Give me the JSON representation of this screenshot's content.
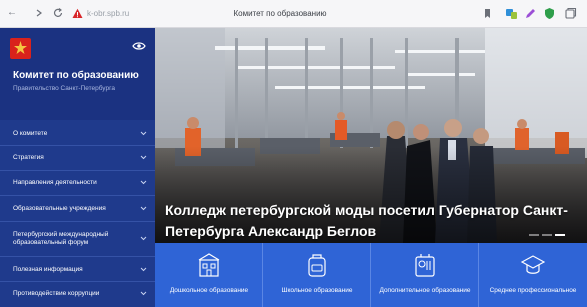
{
  "browser": {
    "url": "k-obr.spb.ru",
    "tab_title": "Комитет по образованию",
    "icons": [
      "back-icon",
      "forward-icon",
      "reload-icon",
      "warning-icon",
      "bookmark-icon",
      "extensions-icon",
      "pen-icon",
      "shield-icon",
      "tabs-icon"
    ]
  },
  "sidebar": {
    "title": "Комитет по образованию",
    "subtitle": "Правительство Санкт-Петербурга",
    "menu": [
      {
        "label": "О комитете"
      },
      {
        "label": "Стратегия"
      },
      {
        "label": "Направления деятельности"
      },
      {
        "label": "Образовательные учреждения"
      },
      {
        "label": "Петербургский международный образовательный форум"
      },
      {
        "label": "Полезная информация"
      },
      {
        "label": "Противодействие коррупции"
      }
    ]
  },
  "hero": {
    "caption": "Колледж петербургской моды посетил Губернатор Санкт-Петербурга Александр Беглов",
    "slides_total": 3,
    "active_slide": 3
  },
  "categories": [
    {
      "label": "Дошкольное образование",
      "icon": "preschool-icon"
    },
    {
      "label": "Школьное образование",
      "icon": "school-bag-icon"
    },
    {
      "label": "Дополнительное образование",
      "icon": "extra-education-icon"
    },
    {
      "label": "Среднее профессиональное",
      "icon": "graduation-cap-icon"
    }
  ],
  "colors": {
    "sidebar": "#1f3a8c",
    "category_bar": "#2f64d6",
    "logo": "#d9221c"
  }
}
